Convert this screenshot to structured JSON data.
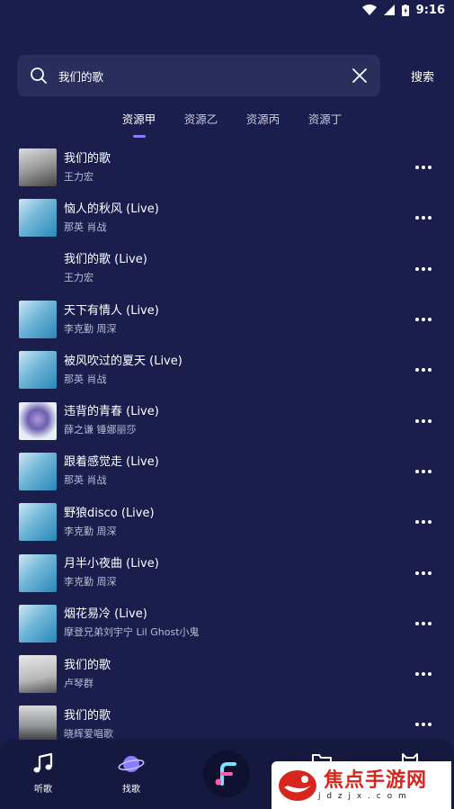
{
  "status_bar": {
    "time": "9:16"
  },
  "search": {
    "value": "我们的歌",
    "button_label": "搜索"
  },
  "tabs": [
    {
      "label": "资源甲",
      "active": true
    },
    {
      "label": "资源乙",
      "active": false
    },
    {
      "label": "资源丙",
      "active": false
    },
    {
      "label": "资源丁",
      "active": false
    }
  ],
  "songs": [
    {
      "title": "我们的歌",
      "artist": "王力宏",
      "cover": "photo1"
    },
    {
      "title": "恼人的秋风 (Live)",
      "artist": "那英  肖战",
      "cover": "blue"
    },
    {
      "title": "我们的歌 (Live)",
      "artist": "王力宏",
      "cover": "none"
    },
    {
      "title": "天下有情人 (Live)",
      "artist": "李克勤  周深",
      "cover": "blue"
    },
    {
      "title": "被风吹过的夏天 (Live)",
      "artist": "那英  肖战",
      "cover": "blue"
    },
    {
      "title": "违背的青春 (Live)",
      "artist": "薛之谦  锤娜丽莎",
      "cover": "purple"
    },
    {
      "title": "跟着感觉走 (Live)",
      "artist": "那英  肖战",
      "cover": "blue"
    },
    {
      "title": "野狼disco (Live)",
      "artist": "李克勤  周深",
      "cover": "blue"
    },
    {
      "title": "月半小夜曲 (Live)",
      "artist": "李克勤  周深",
      "cover": "blue"
    },
    {
      "title": "烟花易冷 (Live)",
      "artist": "摩登兄弟刘宇宁  Lil Ghost小鬼",
      "cover": "blue"
    },
    {
      "title": "我们的歌",
      "artist": "卢琴群",
      "cover": "photo2"
    },
    {
      "title": "我们的歌",
      "artist": "晓辉爱唱歌",
      "cover": "photo3"
    }
  ],
  "bottom_nav": [
    {
      "label": "听歌",
      "icon": "music-note-icon"
    },
    {
      "label": "找歌",
      "icon": "planet-icon"
    }
  ],
  "watermark": {
    "text": "焦点手游网",
    "url": "j d z j x . c o m"
  },
  "colors": {
    "background": "#1b1e4c",
    "search_box": "#2a2e5c",
    "accent": "#8b7cff",
    "nav": "#15183f"
  }
}
